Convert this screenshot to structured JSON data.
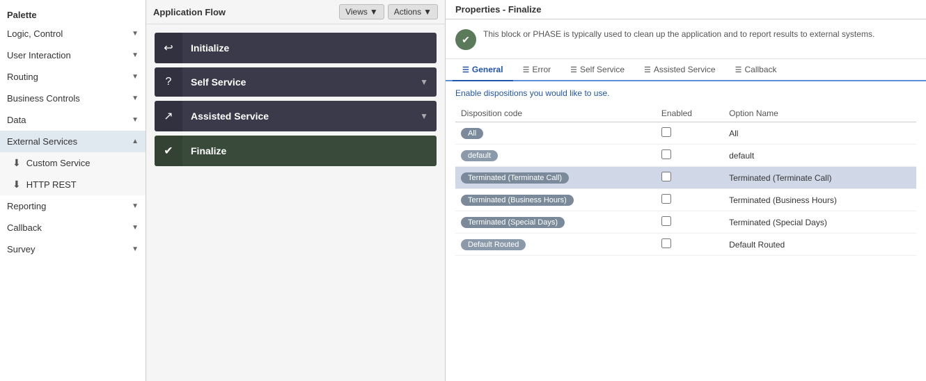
{
  "palette": {
    "title": "Palette",
    "items": [
      {
        "id": "logic-control",
        "label": "Logic, Control",
        "expanded": false,
        "hasChevron": true
      },
      {
        "id": "user-interaction",
        "label": "User Interaction",
        "expanded": false,
        "hasChevron": true
      },
      {
        "id": "routing",
        "label": "Routing",
        "expanded": false,
        "hasChevron": true
      },
      {
        "id": "business-controls",
        "label": "Business Controls",
        "expanded": false,
        "hasChevron": true
      },
      {
        "id": "data",
        "label": "Data",
        "expanded": false,
        "hasChevron": true
      },
      {
        "id": "external-services",
        "label": "External Services",
        "expanded": true,
        "hasChevron": true
      },
      {
        "id": "custom-service",
        "label": "Custom Service",
        "isSubItem": true,
        "icon": "⬇"
      },
      {
        "id": "http-rest",
        "label": "HTTP REST",
        "isSubItem": true,
        "icon": "⬇"
      },
      {
        "id": "reporting",
        "label": "Reporting",
        "expanded": false,
        "hasChevron": true
      },
      {
        "id": "callback",
        "label": "Callback",
        "expanded": false,
        "hasChevron": true
      },
      {
        "id": "survey",
        "label": "Survey",
        "expanded": false,
        "hasChevron": true
      }
    ]
  },
  "appFlow": {
    "title": "Application Flow",
    "viewsLabel": "Views",
    "actionsLabel": "Actions",
    "blocks": [
      {
        "id": "initialize",
        "label": "Initialize",
        "icon": "↩",
        "hasChevron": false
      },
      {
        "id": "self-service",
        "label": "Self Service",
        "icon": "?",
        "hasChevron": true
      },
      {
        "id": "assisted-service",
        "label": "Assisted Service",
        "icon": "↗",
        "hasChevron": true
      },
      {
        "id": "finalize",
        "label": "Finalize",
        "icon": "✔",
        "hasChevron": false,
        "isFinalize": true
      }
    ]
  },
  "properties": {
    "title": "Properties - Finalize",
    "description": "This block or PHASE is typically used to clean up the application and to report results to external systems.",
    "tabs": [
      {
        "id": "general",
        "label": "General",
        "icon": "☰",
        "active": true
      },
      {
        "id": "error",
        "label": "Error",
        "icon": "☰"
      },
      {
        "id": "self-service",
        "label": "Self Service",
        "icon": "☰"
      },
      {
        "id": "assisted-service",
        "label": "Assisted Service",
        "icon": "☰"
      },
      {
        "id": "callback",
        "label": "Callback",
        "icon": "☰"
      }
    ],
    "enableText": "Enable dispositions you would like to use.",
    "tableHeaders": {
      "dispositionCode": "Disposition code",
      "enabled": "Enabled",
      "optionName": "Option Name"
    },
    "rows": [
      {
        "id": "all",
        "badge": "All",
        "badgeClass": "all-badge",
        "enabled": false,
        "optionName": "All",
        "highlighted": false
      },
      {
        "id": "default",
        "badge": "default",
        "badgeClass": "default-badge",
        "enabled": false,
        "optionName": "default",
        "highlighted": false
      },
      {
        "id": "terminated-call",
        "badge": "Terminated (Terminate Call)",
        "badgeClass": "terminated-badge",
        "enabled": false,
        "optionName": "Terminated (Terminate Call)",
        "highlighted": true
      },
      {
        "id": "terminated-business",
        "badge": "Terminated (Business Hours)",
        "badgeClass": "terminated-badge",
        "enabled": false,
        "optionName": "Terminated (Business Hours)",
        "highlighted": false
      },
      {
        "id": "terminated-special",
        "badge": "Terminated (Special Days)",
        "badgeClass": "terminated-badge",
        "enabled": false,
        "optionName": "Terminated (Special Days)",
        "highlighted": false
      },
      {
        "id": "default-routed",
        "badge": "Default Routed",
        "badgeClass": "routed-badge",
        "enabled": false,
        "optionName": "Default Routed",
        "highlighted": false
      }
    ]
  }
}
